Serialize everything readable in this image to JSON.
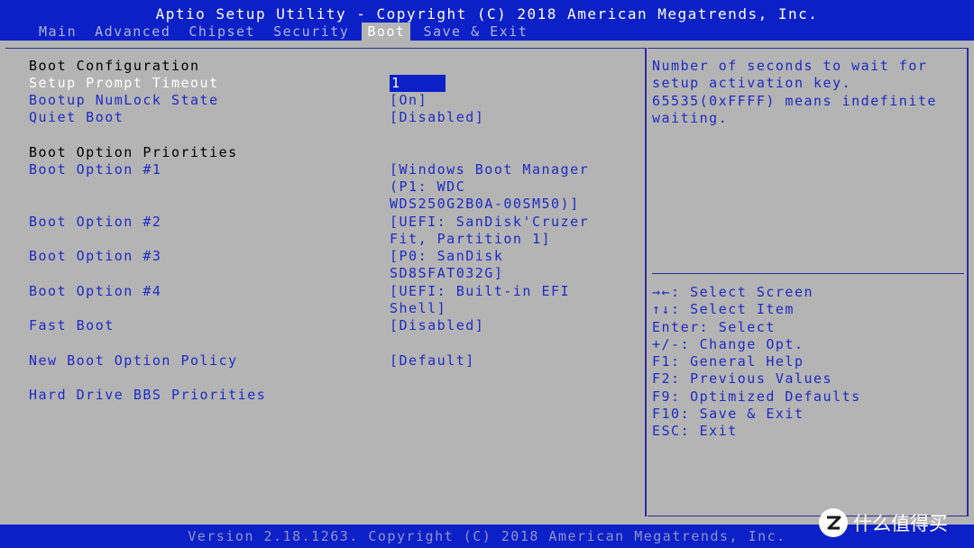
{
  "window": {
    "title": "Aptio Setup Utility - Copyright (C) 2018 American Megatrends, Inc."
  },
  "tabs": [
    {
      "label": "Main"
    },
    {
      "label": "Advanced"
    },
    {
      "label": "Chipset"
    },
    {
      "label": "Security"
    },
    {
      "label": "Boot",
      "active": true
    },
    {
      "label": "Save & Exit"
    }
  ],
  "boot": {
    "config_header": "Boot Configuration",
    "setup_prompt_timeout": {
      "label": "Setup Prompt Timeout",
      "value": "1"
    },
    "numlock": {
      "label": "Bootup NumLock State",
      "value": "[On]"
    },
    "quiet_boot": {
      "label": "Quiet Boot",
      "value": "[Disabled]"
    },
    "priorities_header": "Boot Option Priorities",
    "option1": {
      "label": "Boot Option #1",
      "value": "[Windows Boot Manager\n(P1: WDC\nWDS250G2B0A-00SM50)]"
    },
    "option2": {
      "label": "Boot Option #2",
      "value": "[UEFI: SanDisk'Cruzer\nFit, Partition 1]"
    },
    "option3": {
      "label": "Boot Option #3",
      "value": "[P0: SanDisk\nSD8SFAT032G]"
    },
    "option4": {
      "label": "Boot Option #4",
      "value": "[UEFI: Built-in EFI\nShell]"
    },
    "fast_boot": {
      "label": "Fast Boot",
      "value": "[Disabled]"
    },
    "new_boot_policy": {
      "label": "New Boot Option Policy",
      "value": "[Default]"
    },
    "hdd_bbs": {
      "label": "Hard Drive BBS Priorities"
    }
  },
  "help": {
    "text": "Number of seconds to wait for\nsetup activation key.\n65535(0xFFFF) means indefinite\nwaiting.",
    "keys": "→←: Select Screen\n↑↓: Select Item\nEnter: Select\n+/-: Change Opt.\nF1: General Help\nF2: Previous Values\nF9: Optimized Defaults\nF10: Save & Exit\nESC: Exit"
  },
  "footer": {
    "version": "Version 2.18.1263. Copyright (C) 2018 American Megatrends, Inc."
  },
  "watermark": {
    "logo_icon": "zhi-logo-icon",
    "text": "什么值得买"
  },
  "colors": {
    "bar_blue": "#0c20c8",
    "panel_gray": "#b4b4b4",
    "text_blue": "#1e2bc4",
    "selected_text": "#ffffff"
  }
}
